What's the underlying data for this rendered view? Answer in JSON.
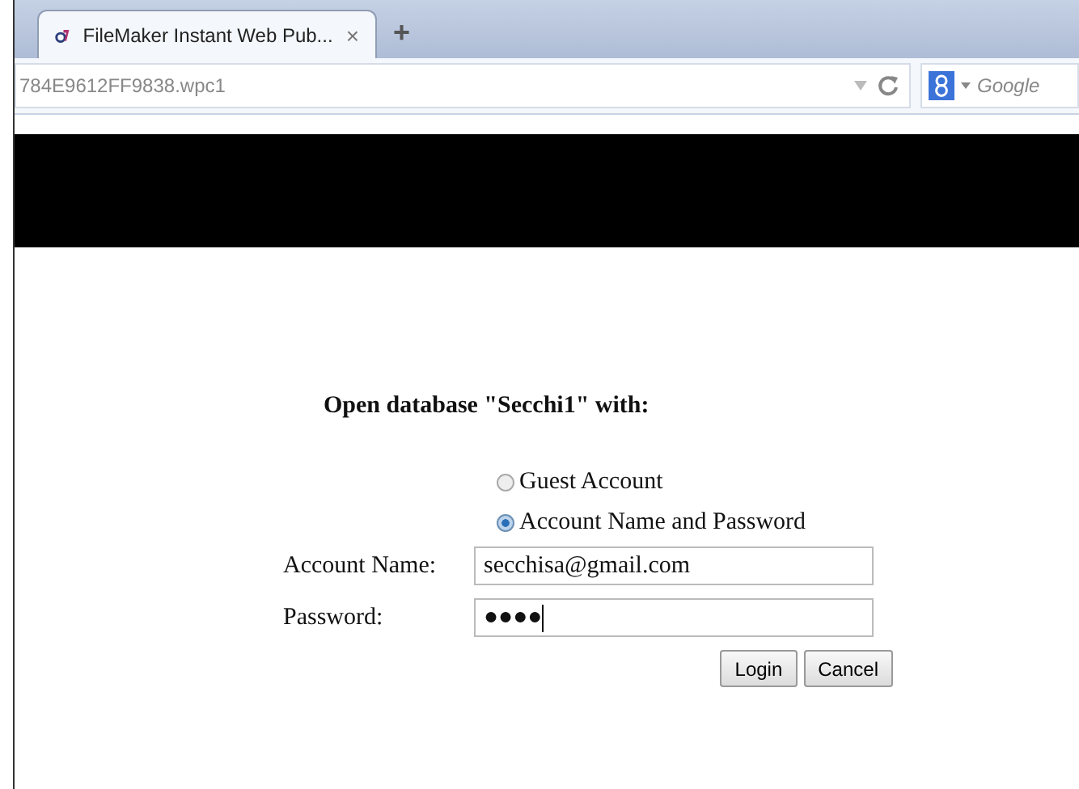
{
  "browser": {
    "tabs": [
      {
        "title": "FileMaker Instant Web Pub...",
        "selected": true
      }
    ],
    "close_tab": "×",
    "new_tab": "+",
    "address": "784E9612FF9838.wpc1",
    "search_engine": "Google"
  },
  "login": {
    "heading": "Open database \"Secchi1\" with:",
    "options": [
      {
        "label": "Guest Account",
        "selected": false
      },
      {
        "label": "Account Name and Password",
        "selected": true
      }
    ],
    "fields": [
      {
        "label": "Account Name:",
        "value": "secchisa@gmail.com"
      },
      {
        "label": "Password:",
        "value": "●●●●"
      }
    ],
    "buttons": [
      "Login",
      "Cancel"
    ]
  }
}
